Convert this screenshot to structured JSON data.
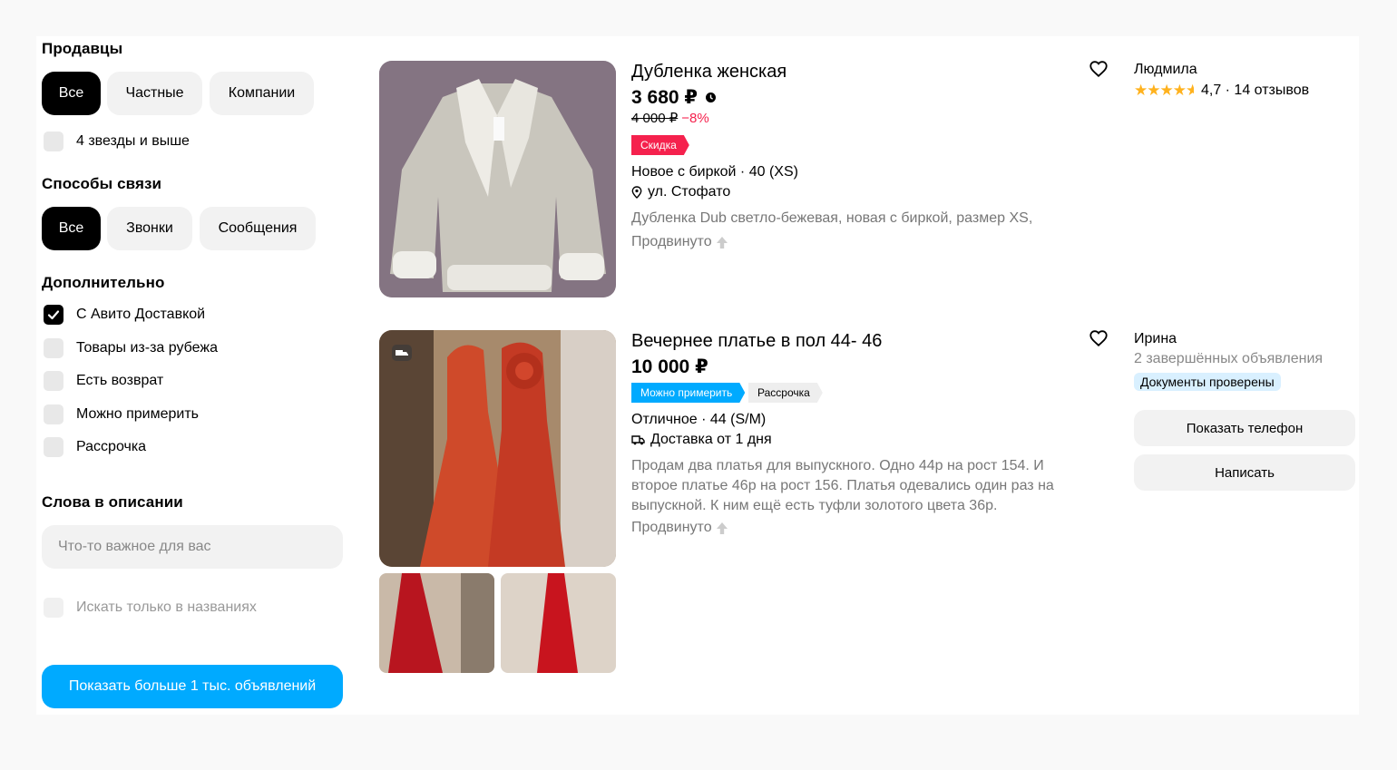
{
  "filters": {
    "sellers": {
      "heading": "Продавцы",
      "chips": [
        {
          "label": "Все",
          "active": true
        },
        {
          "label": "Частные",
          "active": false
        },
        {
          "label": "Компании",
          "active": false
        }
      ],
      "four_stars_label": "4 звезды и выше",
      "four_stars_checked": false
    },
    "contact": {
      "heading": "Способы связи",
      "chips": [
        {
          "label": "Все",
          "active": true
        },
        {
          "label": "Звонки",
          "active": false
        },
        {
          "label": "Сообщения",
          "active": false
        }
      ]
    },
    "extra": {
      "heading": "Дополнительно",
      "options": [
        {
          "label": "С Авито Доставкой",
          "checked": true
        },
        {
          "label": "Товары из-за рубежа",
          "checked": false
        },
        {
          "label": "Есть возврат",
          "checked": false
        },
        {
          "label": "Можно примерить",
          "checked": false
        },
        {
          "label": "Рассрочка",
          "checked": false
        }
      ]
    },
    "keywords": {
      "heading": "Слова в описании",
      "placeholder": "Что-то важное для вас",
      "value": "",
      "titles_only_label": "Искать только в названиях",
      "titles_only_checked": false
    },
    "submit_label": "Показать больше 1 тыс. объявлений"
  },
  "listings": [
    {
      "title": "Дубленка женская",
      "price": "3 680 ₽",
      "old_price": "4 000 ₽",
      "discount": "−8%",
      "badge": "Скидка",
      "condition": "Новое с биркой · 40 (XS)",
      "location": "ул. Стофато",
      "description": "Дубленка Dub светло-бежевая, новая с биркой, размер XS,",
      "promoted": "Продвинуто",
      "seller": {
        "name": "Людмила",
        "rating_value": 4.7,
        "rating_text": "4,7 · 14 отзывов"
      }
    },
    {
      "title": "Вечернее платье в пол 44- 46",
      "price": "10 000 ₽",
      "badges": [
        "Можно примерить",
        "Рассрочка"
      ],
      "condition": "Отличное · 44 (S/M)",
      "delivery": "Доставка от 1 дня",
      "description": "Продам два платья для выпускного. Одно 44р на рост 154. И второе платье 46р на рост 156. Платья одевались один раз на выпускной. К ним ещё есть туфли золотого цвета 36р.",
      "promoted": "Продвинуто",
      "seller": {
        "name": "Ирина",
        "completed": "2 завершённых объявления",
        "verified": "Документы проверены"
      },
      "show_phone_label": "Показать телефон",
      "write_label": "Написать"
    }
  ],
  "colors": {
    "accent": "#00aaff",
    "discount_red": "#f5214d",
    "try_on_blue": "#00aaff",
    "star": "#ffb21e"
  }
}
